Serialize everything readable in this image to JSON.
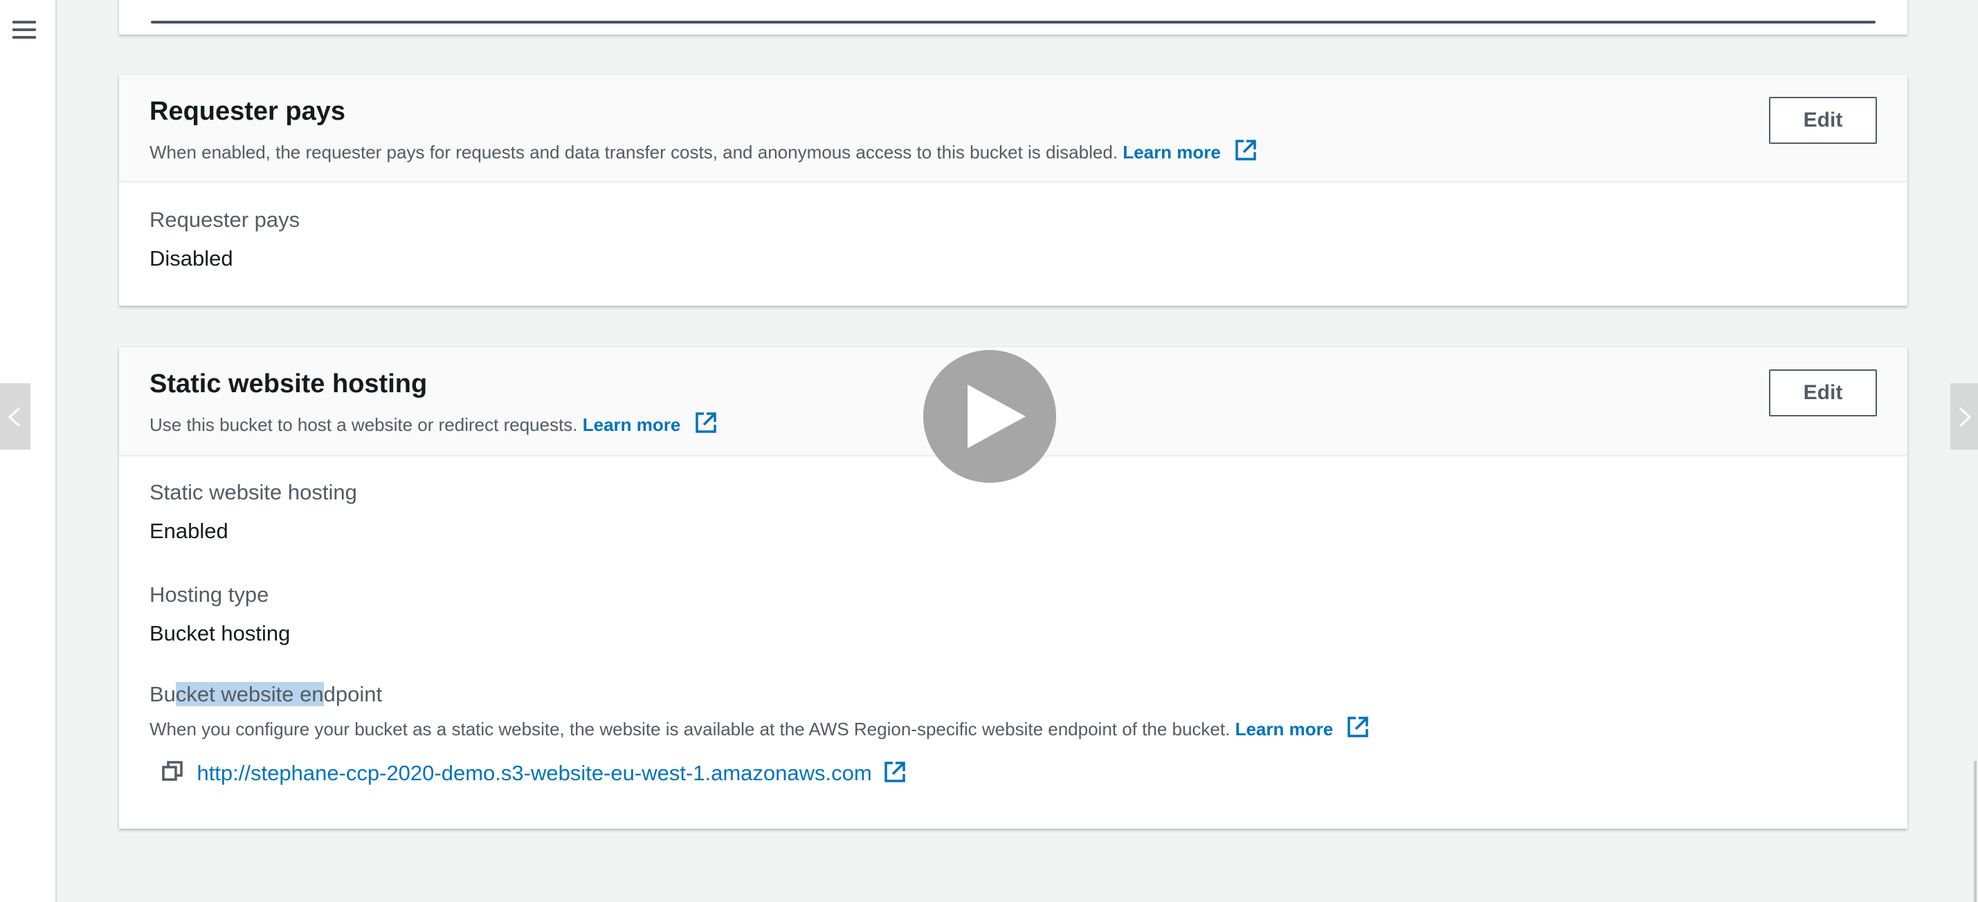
{
  "requester_pays": {
    "title": "Requester pays",
    "description": "When enabled, the requester pays for requests and data transfer costs, and anonymous access to this bucket is disabled.",
    "learn_more": "Learn more",
    "edit_label": "Edit",
    "field_label": "Requester pays",
    "field_value": "Disabled"
  },
  "static_hosting": {
    "title": "Static website hosting",
    "description": "Use this bucket to host a website or redirect requests.",
    "learn_more": "Learn more",
    "edit_label": "Edit",
    "status_label": "Static website hosting",
    "status_value": "Enabled",
    "type_label": "Hosting type",
    "type_value": "Bucket hosting",
    "endpoint_label_part1": "Bu",
    "endpoint_label_highlight": "cket website en",
    "endpoint_label_part2": "dpoint",
    "endpoint_description": "When you configure your bucket as a static website, the website is available at the AWS Region-specific website endpoint of the bucket.",
    "endpoint_learn_more": "Learn more",
    "endpoint_url": "http://stephane-ccp-2020-demo.s3-website-eu-west-1.amazonaws.com"
  },
  "icons": {
    "menu": "hamburger-menu-icon",
    "external": "external-link-icon",
    "copy": "copy-icon",
    "play": "play-icon",
    "prev": "chevron-left-icon",
    "next": "chevron-right-icon"
  },
  "colors": {
    "link": "#0073bb",
    "highlight": "#b8d4ec",
    "background": "#f2f3f3"
  }
}
